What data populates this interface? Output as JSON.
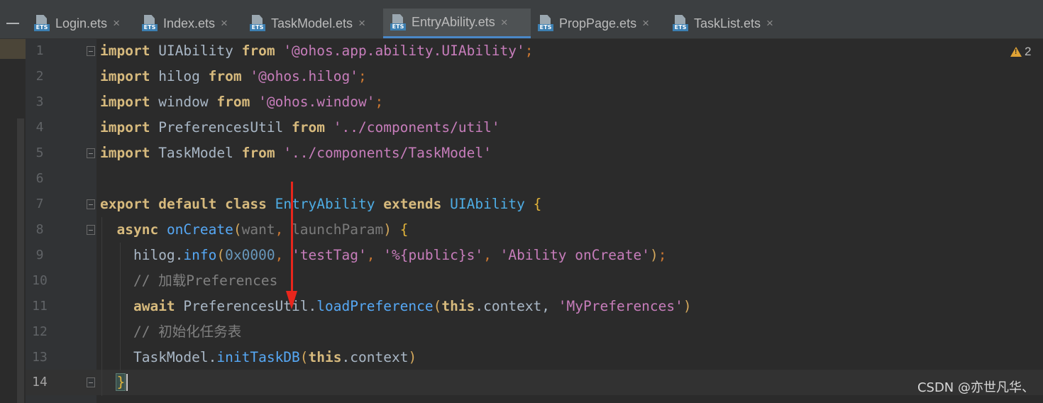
{
  "tabs": [
    {
      "label": "Login.ets",
      "active": false
    },
    {
      "label": "Index.ets",
      "active": false
    },
    {
      "label": "TaskModel.ets",
      "active": false
    },
    {
      "label": "EntryAbility.ets",
      "active": true
    },
    {
      "label": "PropPage.ets",
      "active": false
    },
    {
      "label": "TaskList.ets",
      "active": false
    }
  ],
  "tab_close_glyph": "×",
  "file_icon_badge": "ETS",
  "line_numbers": [
    "1",
    "2",
    "3",
    "4",
    "5",
    "6",
    "7",
    "8",
    "9",
    "10",
    "11",
    "12",
    "13",
    "14"
  ],
  "current_line": "14",
  "warning_count": "2",
  "code": {
    "l1": [
      "import",
      " UIAbility ",
      "from",
      " ",
      "'@ohos.app.ability.UIAbility'",
      ";"
    ],
    "l2": [
      "import",
      " hilog ",
      "from",
      " ",
      "'@ohos.hilog'",
      ";"
    ],
    "l3": [
      "import",
      " window ",
      "from",
      " ",
      "'@ohos.window'",
      ";"
    ],
    "l4": [
      "import",
      " PreferencesUtil ",
      "from",
      " ",
      "'../components/util'"
    ],
    "l5": [
      "import",
      " TaskModel ",
      "from",
      " ",
      "'../components/TaskModel'"
    ],
    "l7": [
      "export",
      " ",
      "default",
      " ",
      "class",
      " ",
      "EntryAbility",
      " ",
      "extends",
      " ",
      "UIAbility",
      " ",
      "{"
    ],
    "l8": [
      "  ",
      "async",
      " ",
      "onCreate",
      "(",
      "want",
      ", ",
      "launchParam",
      ")",
      " ",
      "{"
    ],
    "l9": [
      "    ",
      "hilog",
      ".",
      "info",
      "(",
      "0x0000",
      ", ",
      "'testTag'",
      ", ",
      "'%{public}s'",
      ", ",
      "'Ability onCreate'",
      ")",
      ";"
    ],
    "l10": [
      "    ",
      "// 加载Preferences"
    ],
    "l11": [
      "    ",
      "await",
      " ",
      "PreferencesUtil",
      ".",
      "loadPreference",
      "(",
      "this",
      ".context, ",
      "'MyPreferences'",
      ")"
    ],
    "l12": [
      "    ",
      "// 初始化任务表"
    ],
    "l13": [
      "    ",
      "TaskModel",
      ".",
      "initTaskDB",
      "(",
      "this",
      ".context",
      ")"
    ],
    "l14": [
      "  ",
      "}"
    ]
  },
  "colors": {
    "editor_bg": "#2b2b2b",
    "gutter_bg": "#313335",
    "tab_bar_bg": "#3c3f41",
    "active_tab_underline": "#4a88c7",
    "annotation_arrow": "#e8261c",
    "keyword": "#d7ba7d",
    "string": "#6a8759",
    "function": "#56a8f5",
    "comment": "#808080"
  },
  "watermark": "CSDN @亦世凡华、"
}
